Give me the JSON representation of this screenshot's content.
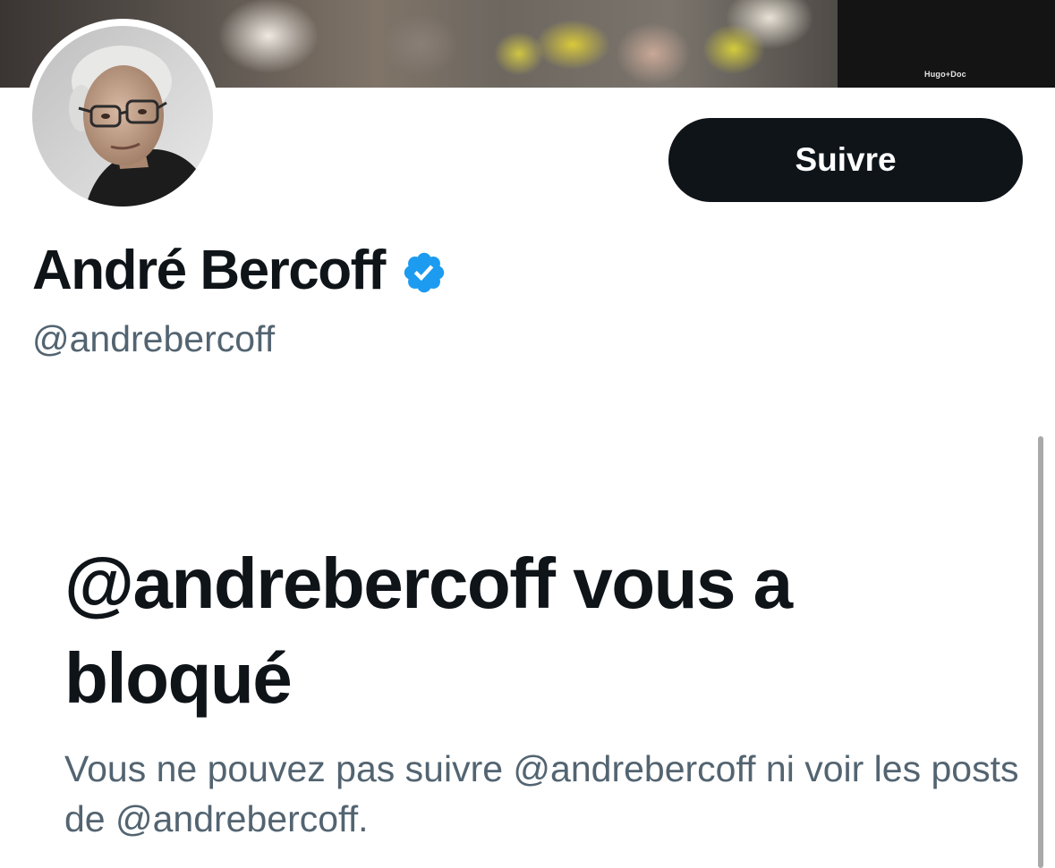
{
  "profile": {
    "display_name": "André Bercoff",
    "handle": "@andrebercoff",
    "verified": true,
    "banner_watermark": "Hugo+Doc"
  },
  "actions": {
    "follow_label": "Suivre"
  },
  "blocked": {
    "title": "@andrebercoff vous a bloqué",
    "description": "Vous ne pouvez pas suivre @andrebercoff ni voir les posts de @andrebercoff."
  },
  "colors": {
    "text_primary": "#0f1419",
    "text_secondary": "#536471",
    "verified_blue": "#1d9bf0",
    "button_bg": "#0f1419",
    "button_text": "#ffffff"
  },
  "icons": {
    "verified": "verified-badge-icon",
    "avatar": "profile-avatar"
  }
}
